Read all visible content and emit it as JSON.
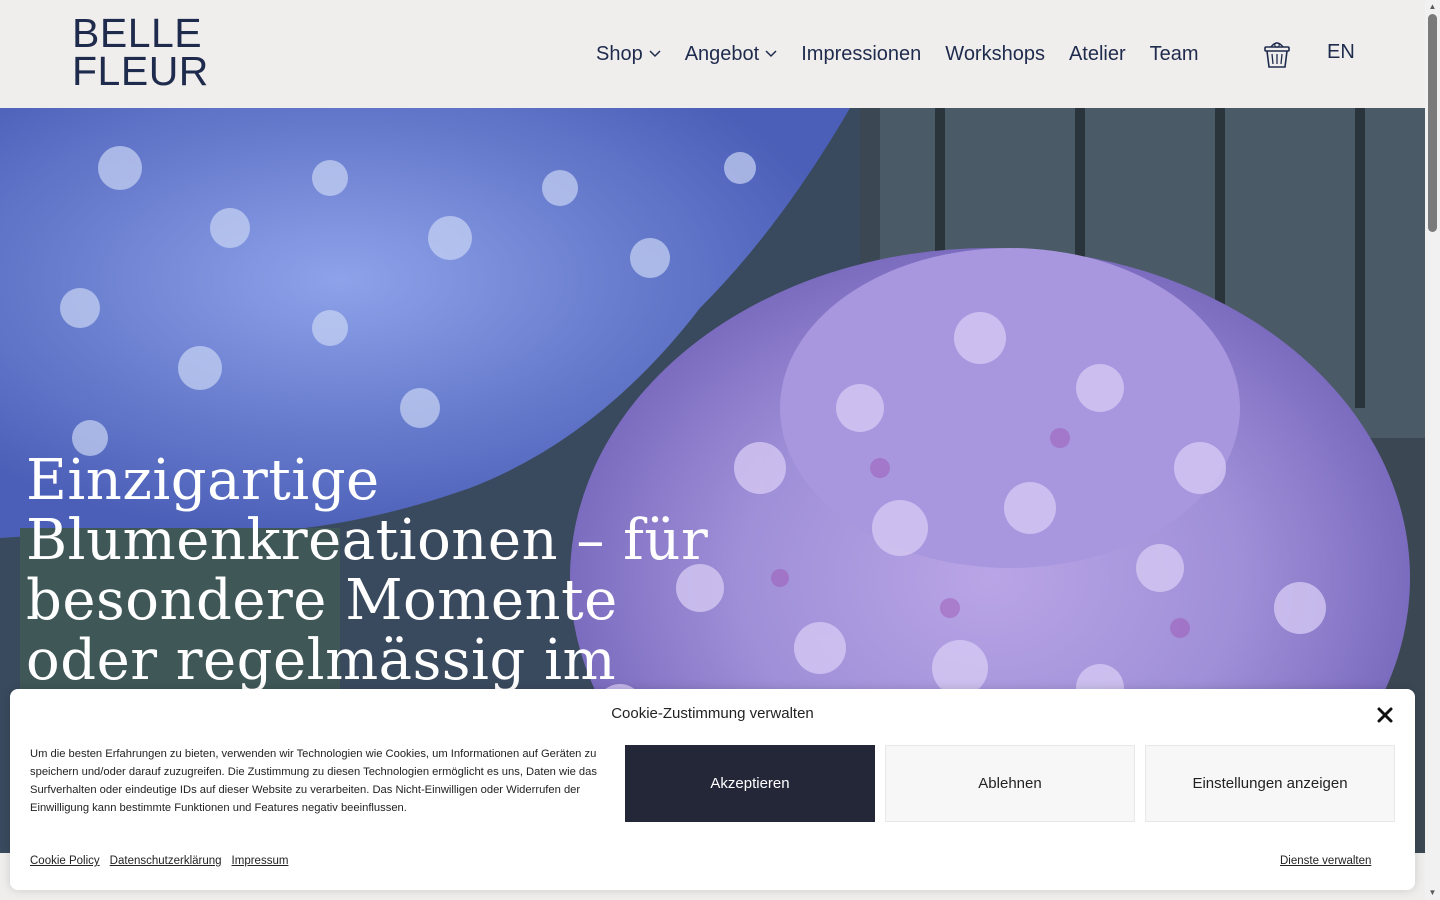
{
  "header": {
    "logo_line1": "BELLE",
    "logo_line2": "FLEUR",
    "nav": [
      {
        "label": "Shop",
        "has_dropdown": true
      },
      {
        "label": "Angebot",
        "has_dropdown": true
      },
      {
        "label": "Impressionen",
        "has_dropdown": false
      },
      {
        "label": "Workshops",
        "has_dropdown": false
      },
      {
        "label": "Atelier",
        "has_dropdown": false
      },
      {
        "label": "Team",
        "has_dropdown": false
      }
    ],
    "cart_icon": "basket-icon",
    "language": "EN"
  },
  "hero": {
    "title_lines": [
      "Einzigartige",
      "Blumenkreationen – für",
      "besondere Momente",
      "oder regelmässig im"
    ]
  },
  "cookie": {
    "title": "Cookie-Zustimmung verwalten",
    "text": "Um die besten Erfahrungen zu bieten, verwenden wir Technologien wie Cookies, um Informationen auf Geräten zu speichern und/oder darauf zuzugreifen. Die Zustimmung zu diesen Technologien ermöglicht es uns, Daten wie das Surfverhalten oder eindeutige IDs auf dieser Website zu verarbeiten. Das Nicht-Einwilligen oder Widerrufen der Einwilligung kann bestimmte Funktionen und Features negativ beeinflussen.",
    "accept": "Akzeptieren",
    "deny": "Ablehnen",
    "settings": "Einstellungen anzeigen",
    "links": [
      "Cookie Policy",
      "Datenschutzerklärung",
      "Impressum"
    ],
    "manage": "Dienste verwalten"
  },
  "colors": {
    "brand": "#1f2b4d",
    "accept_button": "#232738",
    "header_bg": "#efeeec"
  }
}
